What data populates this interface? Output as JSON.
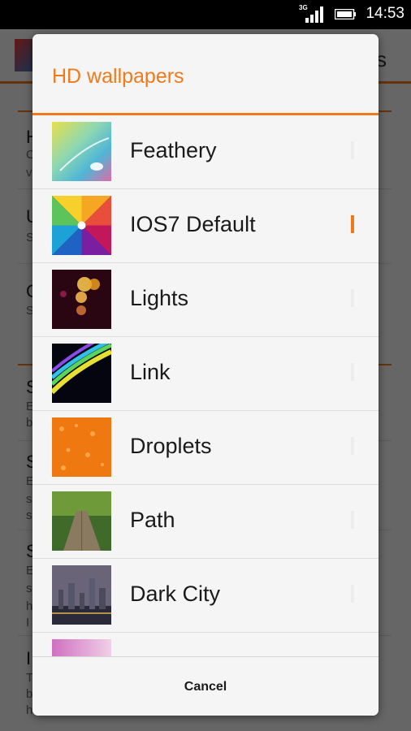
{
  "status_bar": {
    "network": "3G",
    "time": "14:53"
  },
  "background_app": {
    "header_letter": "s",
    "letters": [
      "H",
      "U",
      "C",
      "S",
      "S",
      "S",
      "I"
    ],
    "sub_letters": [
      "C",
      "v",
      "S",
      "S",
      "E",
      "b",
      "E",
      "s",
      "s",
      "E",
      "s",
      "h",
      "I",
      "T",
      "b",
      "h"
    ]
  },
  "dialog": {
    "title": "HD wallpapers",
    "cancel_label": "Cancel",
    "items": [
      {
        "label": "Feathery",
        "selected": false
      },
      {
        "label": "IOS7 Default",
        "selected": true
      },
      {
        "label": "Lights",
        "selected": false
      },
      {
        "label": "Link",
        "selected": false
      },
      {
        "label": "Droplets",
        "selected": false
      },
      {
        "label": "Path",
        "selected": false
      },
      {
        "label": "Dark City",
        "selected": false
      },
      {
        "label": "",
        "selected": false
      }
    ]
  },
  "colors": {
    "accent": "#f07a1a",
    "status_bar": "#000000"
  }
}
